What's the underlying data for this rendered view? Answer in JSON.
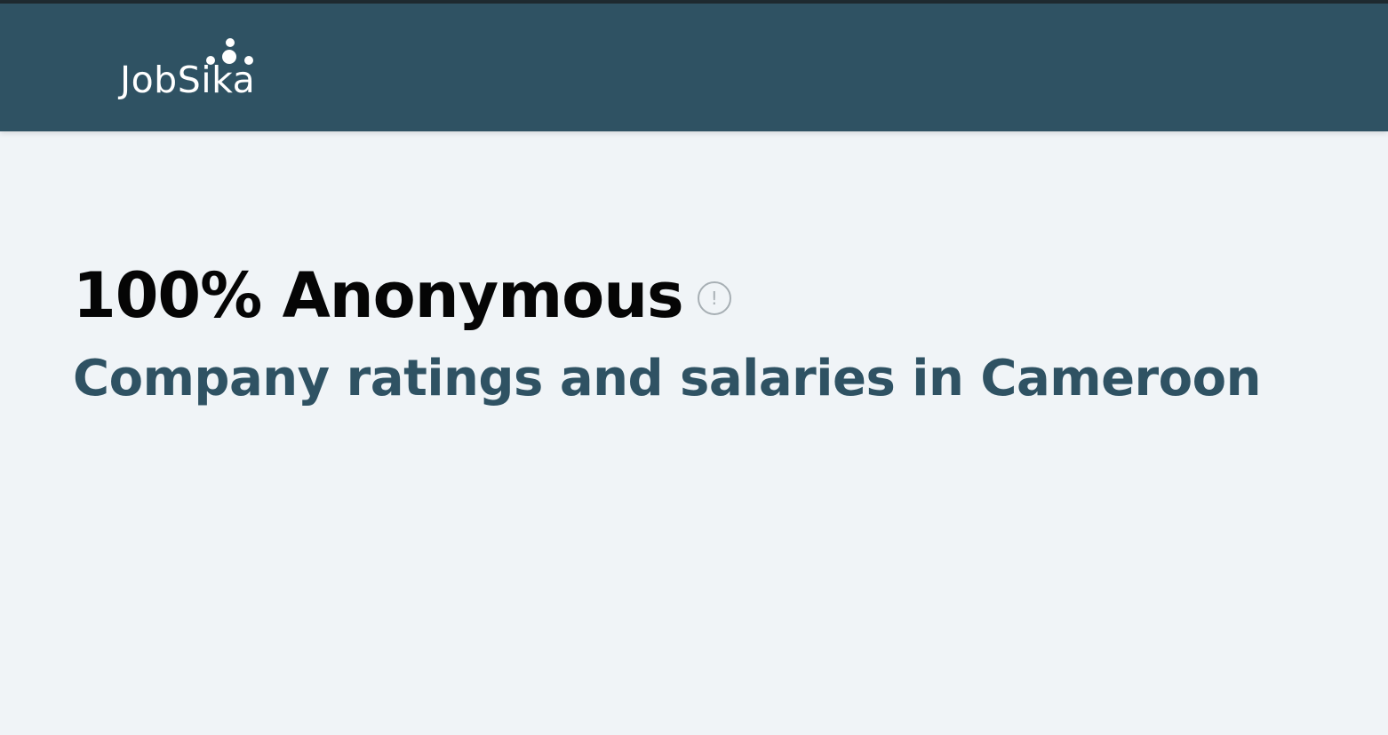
{
  "header": {
    "brand_name": "JobSika",
    "background_color": "#2f5263",
    "logo_icon": "dots-icon"
  },
  "hero": {
    "title": "100% Anonymous",
    "info_icon_glyph": "!",
    "info_icon": "info-icon",
    "subtitle": "Company ratings and salaries in Cameroon",
    "subtitle_color": "#2f5263"
  },
  "page": {
    "background_color": "#f0f4f7"
  }
}
